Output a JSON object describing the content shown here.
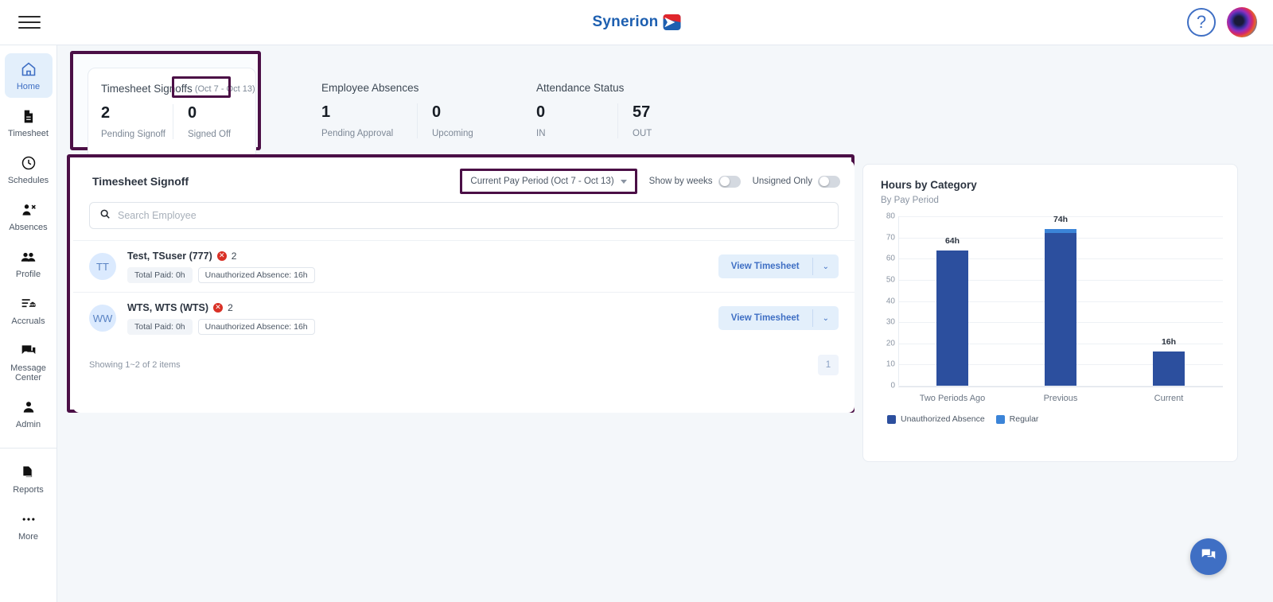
{
  "header": {
    "menu_icon": "hamburger-menu-icon",
    "logo_text": "Synerion",
    "help_icon": "?",
    "avatar": "user-avatar"
  },
  "sidebar": {
    "items": [
      {
        "label": "Home",
        "icon": "home-icon",
        "active": true
      },
      {
        "label": "Timesheet",
        "icon": "document-icon",
        "active": false
      },
      {
        "label": "Schedules",
        "icon": "clock-icon",
        "active": false
      },
      {
        "label": "Absences",
        "icon": "person-remove-icon",
        "active": false
      },
      {
        "label": "Profile",
        "icon": "people-icon",
        "active": false
      },
      {
        "label": "Accruals",
        "icon": "list-bank-icon",
        "active": false
      },
      {
        "label": "Message Center",
        "icon": "chat-icon",
        "active": false
      },
      {
        "label": "Admin",
        "icon": "person-icon",
        "active": false
      }
    ],
    "bottom_items": [
      {
        "label": "Reports",
        "icon": "copy-document-icon"
      },
      {
        "label": "More",
        "icon": "ellipsis-icon"
      }
    ]
  },
  "kpi_cards": [
    {
      "title": "Timesheet Signoffs",
      "date_range": "(Oct 7 - Oct 13)",
      "stats": [
        {
          "value": "2",
          "label": "Pending Signoff"
        },
        {
          "value": "0",
          "label": "Signed Off"
        }
      ]
    },
    {
      "title": "Employee Absences",
      "date_range": "",
      "stats": [
        {
          "value": "1",
          "label": "Pending Approval"
        },
        {
          "value": "0",
          "label": "Upcoming"
        }
      ]
    },
    {
      "title": "Attendance Status",
      "date_range": "",
      "stats": [
        {
          "value": "0",
          "label": "IN"
        },
        {
          "value": "57",
          "label": "OUT"
        }
      ]
    }
  ],
  "signoff": {
    "title": "Timesheet Signoff",
    "period_selector": "Current Pay Period (Oct 7 - Oct 13)",
    "toggles": [
      {
        "label": "Show by weeks",
        "on": false
      },
      {
        "label": "Unsigned Only",
        "on": false
      }
    ],
    "search_placeholder": "Search Employee",
    "search_value": "",
    "rows": [
      {
        "initials": "TT",
        "name": "Test, TSuser (777)",
        "error_count": "2",
        "chip_paid": "Total Paid: 0h",
        "chip_absence": "Unauthorized Absence: 16h",
        "action_label": "View Timesheet"
      },
      {
        "initials": "WW",
        "name": "WTS, WTS (WTS)",
        "error_count": "2",
        "chip_paid": "Total Paid: 0h",
        "chip_absence": "Unauthorized Absence: 16h",
        "action_label": "View Timesheet"
      }
    ],
    "showing_text": "Showing 1~2 of 2 items",
    "page_number": "1"
  },
  "chart_data": {
    "type": "bar",
    "title": "Hours by Category",
    "subtitle": "By Pay Period",
    "xlabel": "",
    "ylabel": "",
    "ylim": [
      0,
      80
    ],
    "yticks": [
      0,
      10,
      20,
      30,
      40,
      50,
      60,
      70,
      80
    ],
    "categories": [
      "Two Periods Ago",
      "Previous",
      "Current"
    ],
    "series": [
      {
        "name": "Unauthorized Absence",
        "color": "#2c4f9e",
        "values": [
          64,
          72,
          16
        ]
      },
      {
        "name": "Regular",
        "color": "#3b84d8",
        "values": [
          0,
          2,
          0
        ]
      }
    ],
    "totals": [
      64,
      74,
      16
    ],
    "data_labels": [
      "64h",
      "74h",
      "16h"
    ],
    "stacked": true,
    "grid": true,
    "legend_position": "bottom-left"
  },
  "fab": {
    "icon": "chat-bubble-icon"
  },
  "colors": {
    "highlight_border": "#4b0f46",
    "accent_blue": "#3f6fc4",
    "page_bg": "#f4f7fa",
    "bar_dark": "#2c4f9e",
    "bar_light": "#3b84d8",
    "error_red": "#d93025"
  }
}
